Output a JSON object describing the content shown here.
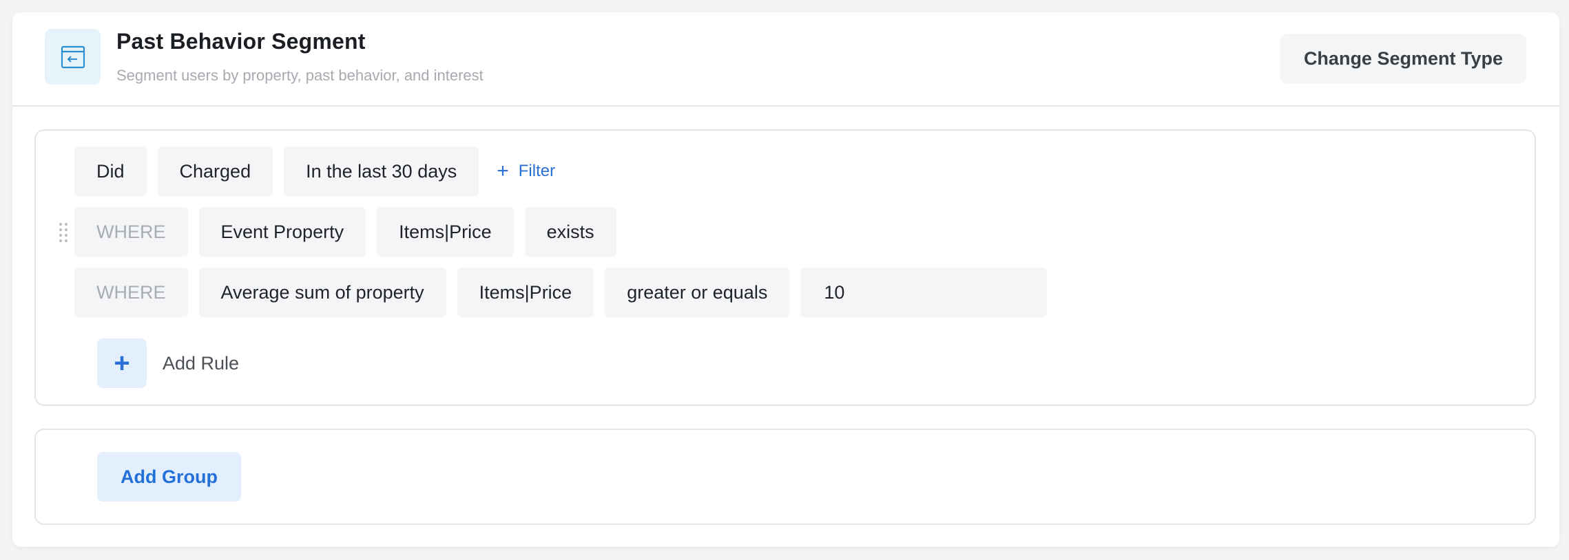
{
  "header": {
    "title": "Past Behavior Segment",
    "subtitle": "Segment users by property, past behavior, and interest",
    "change_label": "Change Segment Type",
    "icon": "segment-back-icon"
  },
  "group": {
    "row1": {
      "did": "Did",
      "event": "Charged",
      "time": "In the last 30 days",
      "filter_label": "Filter"
    },
    "row2": {
      "where": "WHERE",
      "type": "Event Property",
      "property": "Items|Price",
      "operator": "exists"
    },
    "row3": {
      "where": "WHERE",
      "type": "Average sum of property",
      "property": "Items|Price",
      "operator": "greater or equals",
      "value": "10"
    },
    "add_rule_label": "Add Rule"
  },
  "add_group_label": "Add Group",
  "colors": {
    "accent": "#2b6fd6",
    "chip_bg": "#f4f5f7",
    "accent_bg": "#e3effd"
  }
}
